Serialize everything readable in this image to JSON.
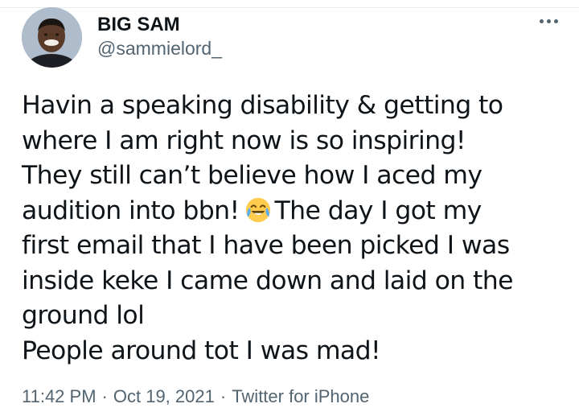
{
  "author": {
    "name": "BIG SAM",
    "handle": "@sammielord_",
    "avatar_icon": "profile-photo"
  },
  "more_icon": "more-horizontal-icon",
  "tweet": {
    "lines": [
      "Havin a speaking disability & getting to",
      "where I am right now is so inspiring!",
      "They still can’t believe how I aced my",
      "audition into bbn!",
      "The day I got my",
      "first email that I have been picked I was",
      "inside keke I came down and laid on the",
      "ground lol",
      "People around tot I was mad!"
    ],
    "emoji": "face-with-tears-of-joy"
  },
  "meta": {
    "time": "11:42 PM",
    "separator": "·",
    "date": "Oct 19, 2021",
    "source": "Twitter for iPhone"
  },
  "colors": {
    "text": "#0f1419",
    "secondary": "#536471",
    "background": "#ffffff"
  }
}
